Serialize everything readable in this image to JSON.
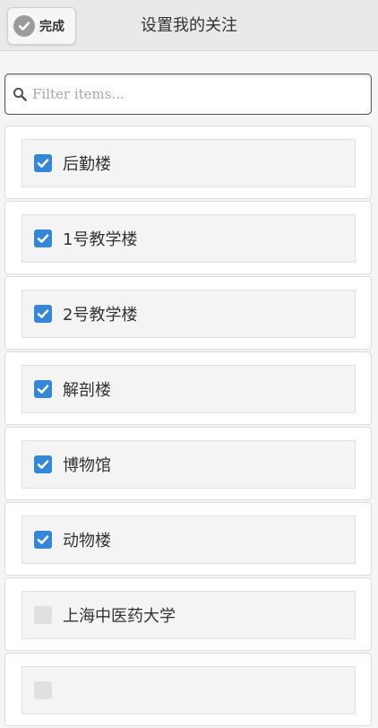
{
  "header": {
    "done_label": "完成",
    "title": "设置我的关注"
  },
  "filter": {
    "placeholder": "Filter items...",
    "value": ""
  },
  "items": [
    {
      "label": "后勤楼",
      "checked": true
    },
    {
      "label": "1号教学楼",
      "checked": true
    },
    {
      "label": "2号教学楼",
      "checked": true
    },
    {
      "label": "解剖楼",
      "checked": true
    },
    {
      "label": "博物馆",
      "checked": true
    },
    {
      "label": "动物楼",
      "checked": true
    },
    {
      "label": "上海中医药大学",
      "checked": false
    },
    {
      "label": "",
      "checked": false
    }
  ],
  "colors": {
    "checked": "#3387d6",
    "unchecked": "#e0e0e0",
    "header_bg": "#e9e9e9"
  },
  "icons": {
    "done": "check-circle-icon",
    "search": "search-icon",
    "checkbox_checked": "checkbox-checked-icon",
    "checkbox_unchecked": "checkbox-unchecked-icon"
  }
}
